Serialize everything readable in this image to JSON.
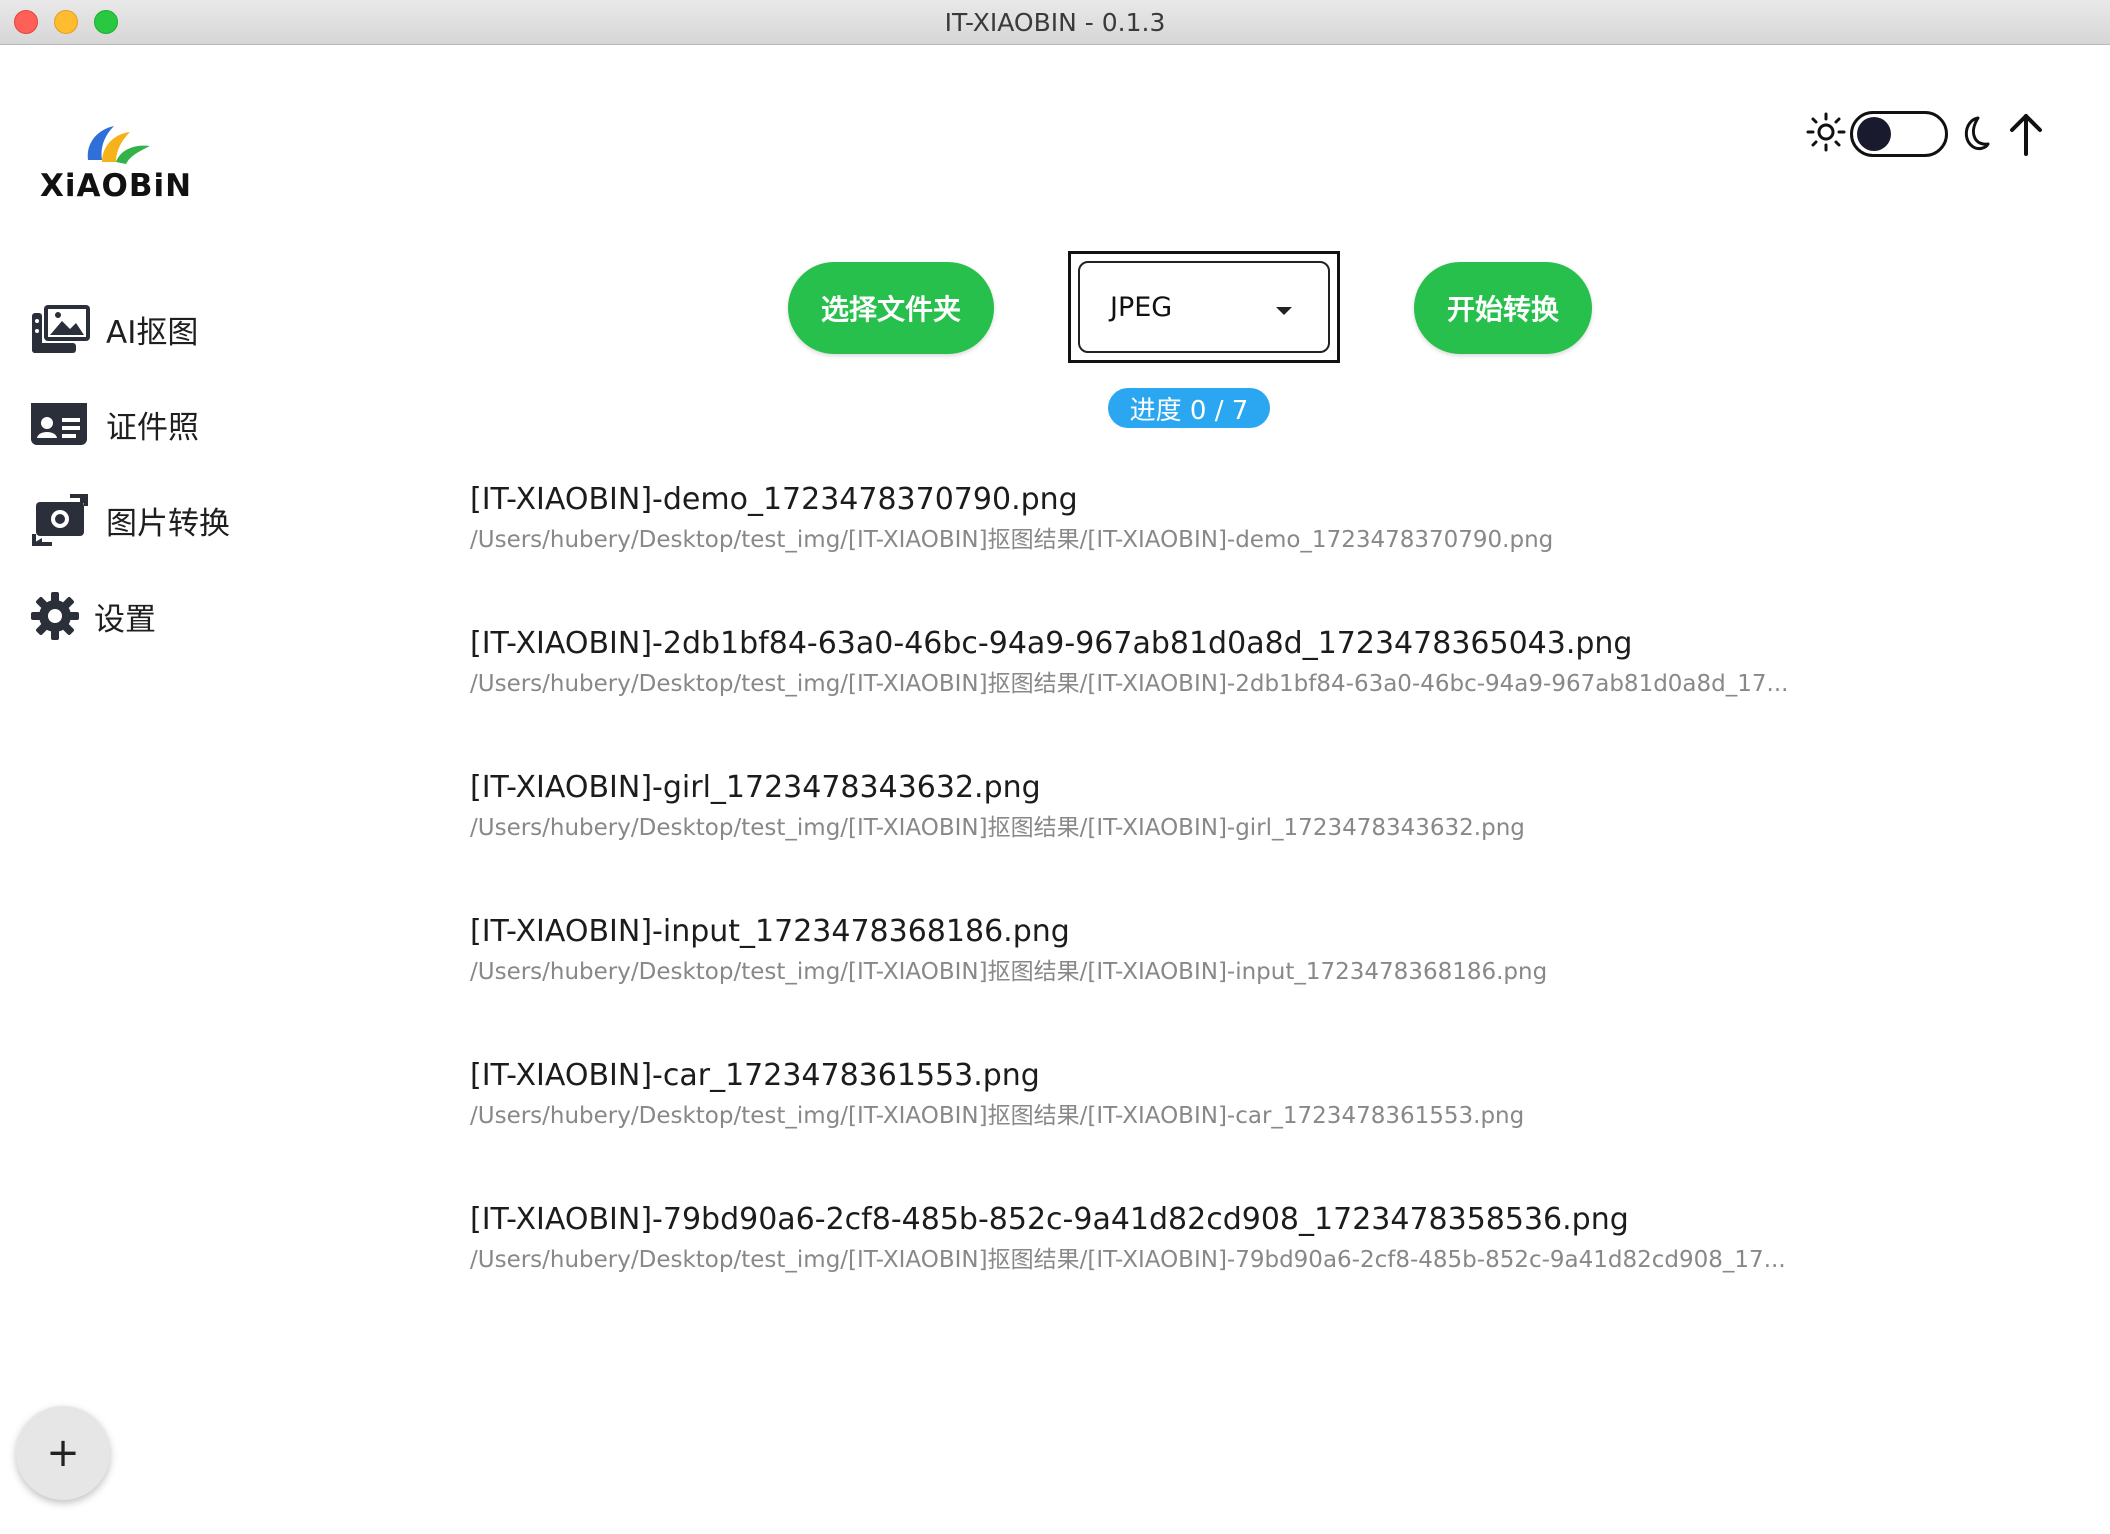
{
  "window": {
    "title": "IT-XIAOBIN - 0.1.3"
  },
  "logo": {
    "text": "XiAOBiN"
  },
  "sidebar": {
    "items": [
      {
        "label": "AI抠图",
        "icon": "image-gallery-icon"
      },
      {
        "label": "证件照",
        "icon": "id-card-icon"
      },
      {
        "label": "图片转换",
        "icon": "image-convert-icon"
      },
      {
        "label": "设置",
        "icon": "gear-icon"
      }
    ],
    "fab_label": "+"
  },
  "header": {
    "theme_toggle": {
      "state": "light",
      "icons": [
        "sun-icon",
        "moon-icon"
      ]
    },
    "upload_icon": "arrow-up-icon"
  },
  "toolbar": {
    "select_folder_label": "选择文件夹",
    "format_value": "JPEG",
    "start_label": "开始转换",
    "progress_label": "进度 0 / 7"
  },
  "files": [
    {
      "name": "[IT-XIAOBIN]-demo_1723478370790.png",
      "path": "/Users/hubery/Desktop/test_img/[IT-XIAOBIN]抠图结果/[IT-XIAOBIN]-demo_1723478370790.png"
    },
    {
      "name": "[IT-XIAOBIN]-2db1bf84-63a0-46bc-94a9-967ab81d0a8d_1723478365043.png",
      "path": "/Users/hubery/Desktop/test_img/[IT-XIAOBIN]抠图结果/[IT-XIAOBIN]-2db1bf84-63a0-46bc-94a9-967ab81d0a8d_17..."
    },
    {
      "name": "[IT-XIAOBIN]-girl_1723478343632.png",
      "path": "/Users/hubery/Desktop/test_img/[IT-XIAOBIN]抠图结果/[IT-XIAOBIN]-girl_1723478343632.png"
    },
    {
      "name": "[IT-XIAOBIN]-input_1723478368186.png",
      "path": "/Users/hubery/Desktop/test_img/[IT-XIAOBIN]抠图结果/[IT-XIAOBIN]-input_1723478368186.png"
    },
    {
      "name": "[IT-XIAOBIN]-car_1723478361553.png",
      "path": "/Users/hubery/Desktop/test_img/[IT-XIAOBIN]抠图结果/[IT-XIAOBIN]-car_1723478361553.png"
    },
    {
      "name": "[IT-XIAOBIN]-79bd90a6-2cf8-485b-852c-9a41d82cd908_1723478358536.png",
      "path": "/Users/hubery/Desktop/test_img/[IT-XIAOBIN]抠图结果/[IT-XIAOBIN]-79bd90a6-2cf8-485b-852c-9a41d82cd908_17..."
    }
  ]
}
